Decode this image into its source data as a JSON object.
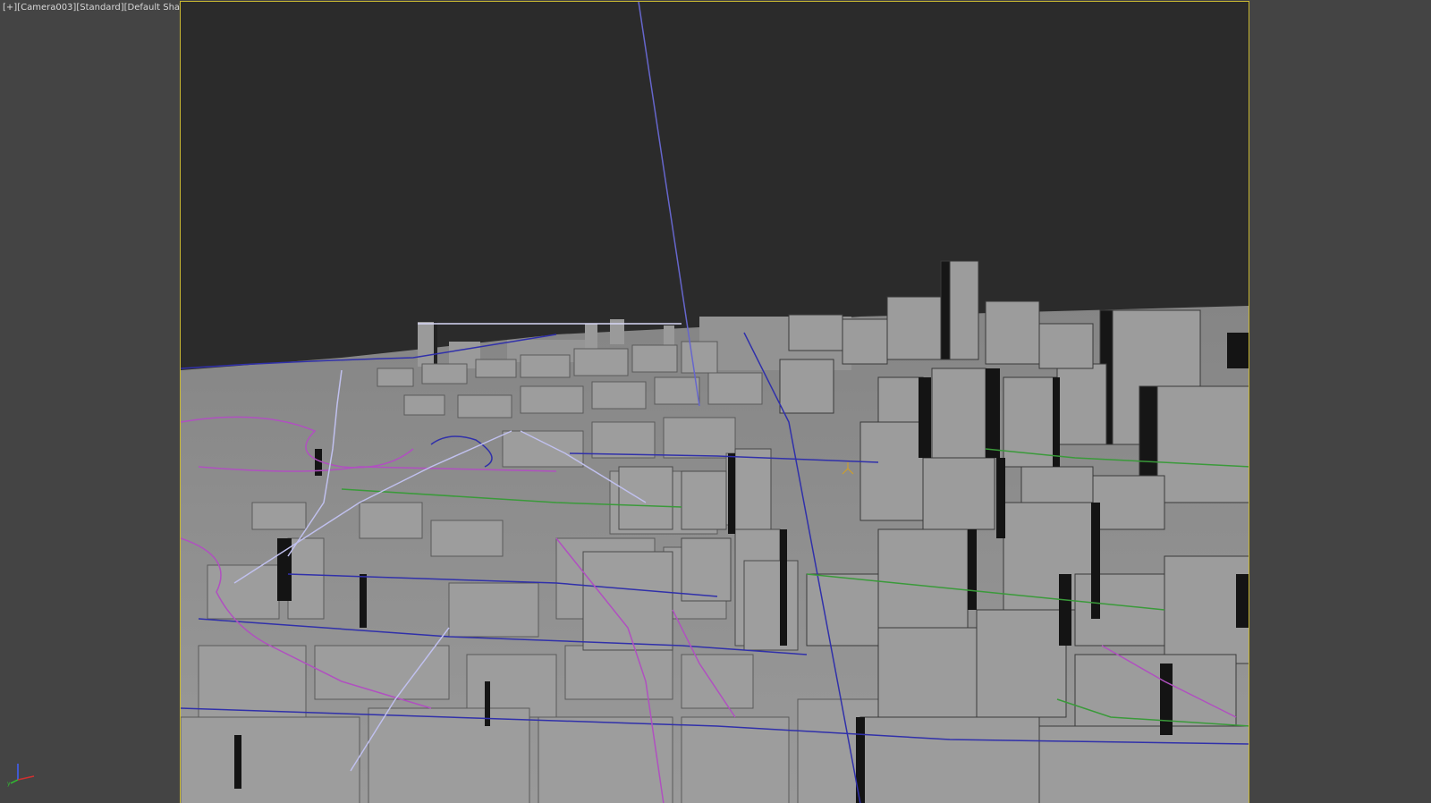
{
  "viewport": {
    "label_parts": [
      "[+]",
      "[Camera003]",
      "[Standard]",
      "[Default Shading]"
    ],
    "border_color": "#c9b832",
    "background": "#2b2b2b"
  },
  "icons": {
    "viewport_filter": "filter-icon",
    "axis_tripod": "axis-gizmo-icon",
    "light_helper": "light-icon"
  },
  "axis_gizmo": {
    "x_color": "#d03030",
    "y_color": "#30c030",
    "z_color": "#4060ff"
  },
  "scene_colors": {
    "ground": "#8a8a8a",
    "building_light": "#9c9c9c",
    "building_dark": "#1a1a1a",
    "spline_blue": "#3333aa",
    "spline_magenta": "#b050c0",
    "spline_green": "#3a9a3a",
    "spline_light": "#b8b8e8"
  }
}
